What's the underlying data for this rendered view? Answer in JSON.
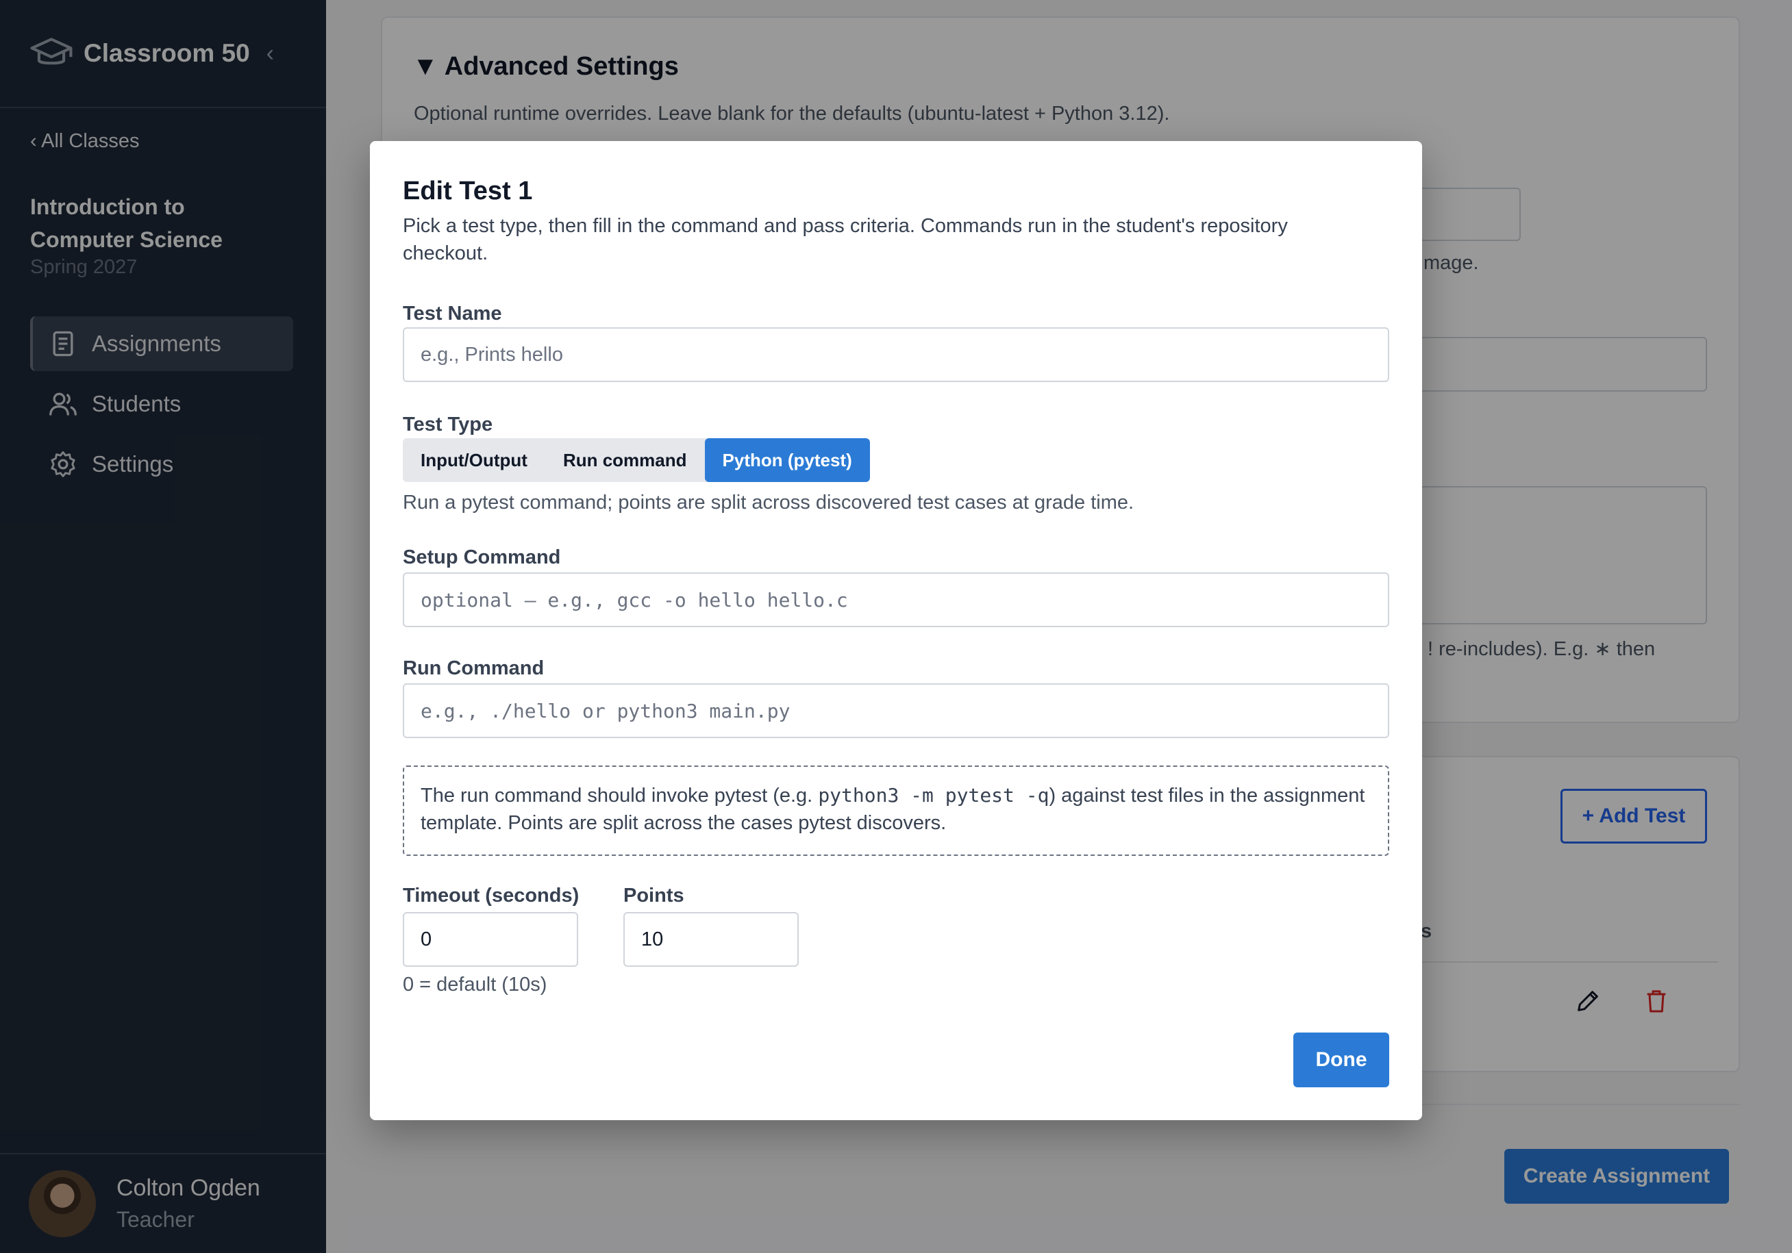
{
  "sidebar": {
    "brand": "Classroom 50",
    "back_link": "‹ All Classes",
    "course_title": "Introduction to Computer Science",
    "course_term": "Spring 2027",
    "nav": [
      {
        "label": "Assignments",
        "icon": "document-icon"
      },
      {
        "label": "Students",
        "icon": "users-icon"
      },
      {
        "label": "Settings",
        "icon": "gear-icon"
      }
    ],
    "user": {
      "name": "Colton Ogden",
      "role": "Teacher"
    }
  },
  "background": {
    "advanced_title": "▼  Advanced Settings",
    "advanced_desc": "Optional runtime overrides. Leave blank for the defaults (ubuntu-latest + Python 3.12).",
    "image_hint_partial": "mage.",
    "exclude_hint_partial": "! re-includes). E.g. ∗ then",
    "column_partial": "s",
    "add_test": "+ Add Test",
    "create_assignment": "Create Assignment"
  },
  "modal": {
    "title": "Edit Test 1",
    "description": "Pick a test type, then fill in the command and pass criteria. Commands run in the student's repository checkout.",
    "test_name": {
      "label": "Test Name",
      "placeholder": "e.g., Prints hello",
      "value": ""
    },
    "test_type": {
      "label": "Test Type",
      "options": [
        "Input/Output",
        "Run command",
        "Python (pytest)"
      ],
      "selected": "Python (pytest)",
      "help": "Run a pytest command; points are split across discovered test cases at grade time."
    },
    "setup_command": {
      "label": "Setup Command",
      "placeholder": "optional — e.g., gcc -o hello hello.c"
    },
    "run_command": {
      "label": "Run Command",
      "placeholder": "e.g., ./hello or python3 main.py"
    },
    "note": {
      "before": "The run command should invoke pytest (e.g. ",
      "code": "python3 -m pytest -q",
      "after": ") against test files in the assignment template. Points are split across the cases pytest discovers."
    },
    "timeout": {
      "label": "Timeout (seconds)",
      "value": "0",
      "help": "0 = default (10s)"
    },
    "points": {
      "label": "Points",
      "value": "10"
    },
    "done": "Done"
  },
  "colors": {
    "primary": "#2b7bd6",
    "sidebar_bg": "#1f2937",
    "danger": "#dc2626"
  }
}
